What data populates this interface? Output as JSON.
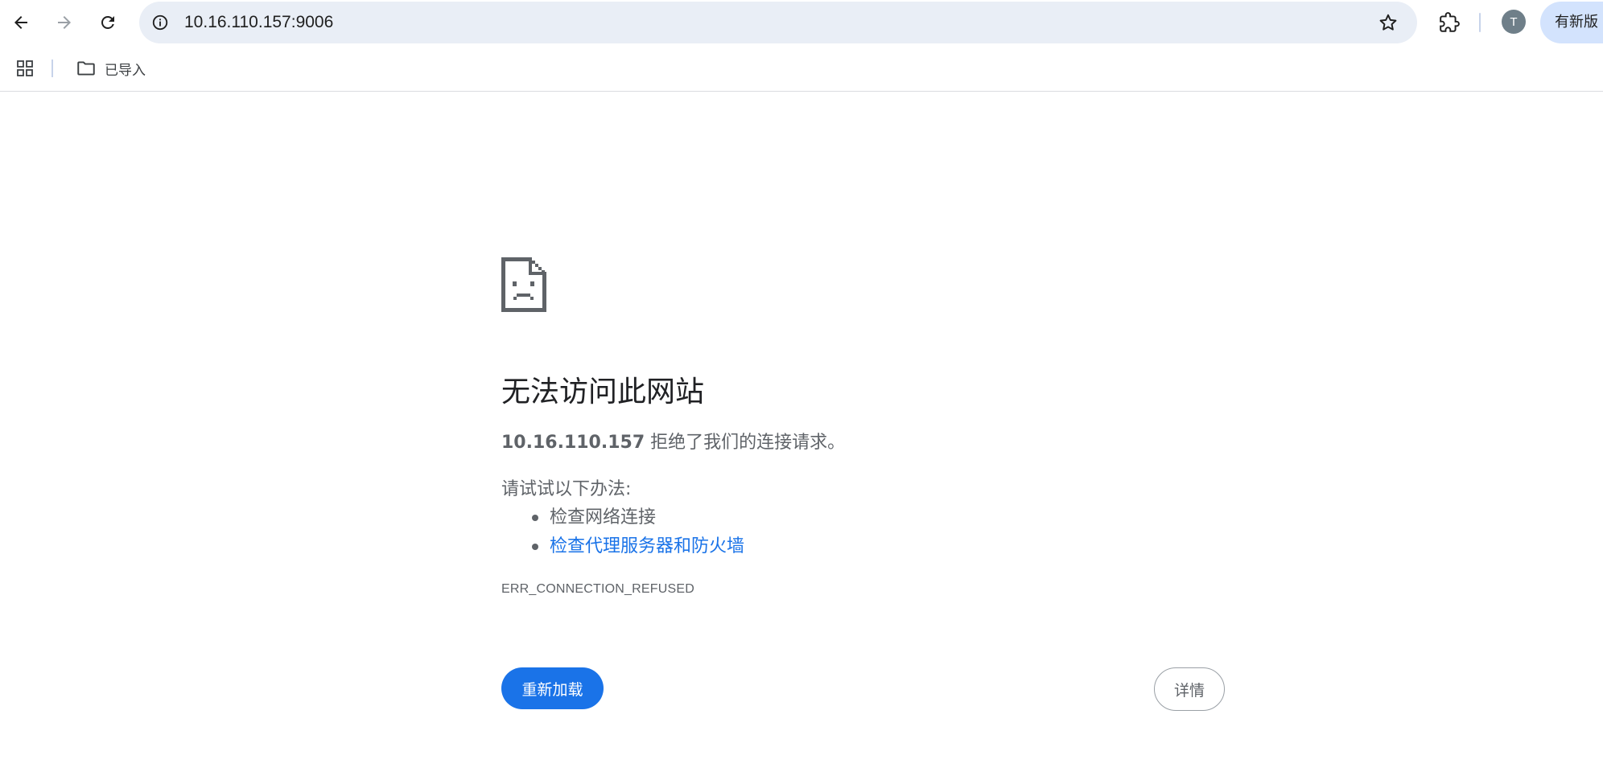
{
  "toolbar": {
    "back_icon": "arrow-left-icon",
    "forward_icon": "arrow-right-icon",
    "reload_icon": "reload-icon",
    "url": "10.16.110.157:9006",
    "site_info_icon": "info-icon",
    "bookmark_icon": "star-icon",
    "extensions_icon": "puzzle-icon",
    "avatar_letter": "T",
    "new_version_label": "有新版"
  },
  "bookmarks": {
    "apps_icon": "apps-grid-icon",
    "folder_icon": "folder-icon",
    "folder_label": "已导入"
  },
  "error": {
    "icon": "sad-page-icon",
    "title": "无法访问此网站",
    "host": "10.16.110.157",
    "message": " 拒绝了我们的连接请求。",
    "suggestions_title": "请试试以下办法:",
    "suggestions": [
      "检查网络连接",
      "检查代理服务器和防火墙"
    ],
    "code": "ERR_CONNECTION_REFUSED",
    "reload_label": "重新加载",
    "details_label": "详情"
  },
  "colors": {
    "accent": "#1a73e8",
    "omnibox_bg": "#e9eef6",
    "new_version_bg": "#d3e3fd",
    "avatar_bg": "#6f7f89",
    "text_secondary": "#5f6368"
  }
}
